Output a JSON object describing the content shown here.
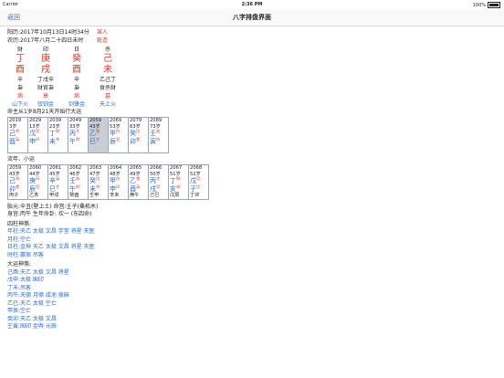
{
  "statusbar": {
    "carrier": "Carrier",
    "time": "2:36 PM",
    "battery": "100%"
  },
  "nav": {
    "back": "返回",
    "title": "八字排盘界面"
  },
  "info": {
    "solar": "阳历:2017年10月13日14时34分",
    "gender": "某人",
    "lunar": "农历:2017年八月二十四日未时",
    "zodiac": "乾造"
  },
  "pillars": [
    {
      "god": "财",
      "stem": "丁",
      "branch": "酉",
      "hidden": "辛",
      "hgods": "枭",
      "state": "病",
      "nayin": "山下火"
    },
    {
      "god": "印",
      "stem": "庚",
      "branch": "戌",
      "hidden": "丁戊辛",
      "hgods": "财官枭",
      "state": "衰",
      "nayin": "钗钏金"
    },
    {
      "god": "日",
      "stem": "癸",
      "branch": "酉",
      "hidden": "辛",
      "hgods": "枭",
      "state": "病",
      "nayin": "剑锋金"
    },
    {
      "god": "杀",
      "stem": "己",
      "branch": "未",
      "hidden": "乙己丁",
      "hgods": "食杀财",
      "state": "墓",
      "nayin": "天上火"
    }
  ],
  "dayun": {
    "title": "命主从1岁8月21天开始行大运",
    "items": [
      {
        "year": "2019",
        "age": "3岁",
        "stem": "己",
        "branch": "酉",
        "sg": "杀",
        "bg": "枭"
      },
      {
        "year": "2029",
        "age": "13岁",
        "stem": "戊",
        "branch": "申",
        "sg": "官",
        "bg": "印"
      },
      {
        "year": "2039",
        "age": "23岁",
        "stem": "丁",
        "branch": "未",
        "sg": "财",
        "bg": "杀"
      },
      {
        "year": "2049",
        "age": "33岁",
        "stem": "丙",
        "branch": "午",
        "sg": "才",
        "bg": "财"
      },
      {
        "year": "2059",
        "age": "43岁",
        "stem": "乙",
        "branch": "巳",
        "sg": "食",
        "bg": "才",
        "sel": true
      },
      {
        "year": "2069",
        "age": "53岁",
        "stem": "甲",
        "branch": "辰",
        "sg": "伤",
        "bg": "官"
      },
      {
        "year": "2079",
        "age": "63岁",
        "stem": "癸",
        "branch": "卯",
        "sg": "比",
        "bg": "食"
      },
      {
        "year": "2089",
        "age": "73岁",
        "stem": "壬",
        "branch": "寅",
        "sg": "劫",
        "bg": "伤"
      }
    ]
  },
  "liunian": {
    "title": "流年、小运",
    "items": [
      {
        "year": "2059",
        "age": "43岁",
        "stem": "己",
        "branch": "卯",
        "sg": "杀",
        "bg": "食",
        "xy": "丙子"
      },
      {
        "year": "2060",
        "age": "44岁",
        "stem": "庚",
        "branch": "辰",
        "sg": "印",
        "bg": "官",
        "xy": "乙亥"
      },
      {
        "year": "2061",
        "age": "45岁",
        "stem": "辛",
        "branch": "巳",
        "sg": "枭",
        "bg": "才",
        "xy": "甲戌"
      },
      {
        "year": "2062",
        "age": "46岁",
        "stem": "壬",
        "branch": "午",
        "sg": "劫",
        "bg": "财",
        "xy": "癸酉"
      },
      {
        "year": "2063",
        "age": "47岁",
        "stem": "癸",
        "branch": "未",
        "sg": "比",
        "bg": "杀",
        "xy": "壬申"
      },
      {
        "year": "2064",
        "age": "48岁",
        "stem": "甲",
        "branch": "申",
        "sg": "伤",
        "bg": "印",
        "xy": "辛未"
      },
      {
        "year": "2065",
        "age": "49岁",
        "stem": "乙",
        "branch": "酉",
        "sg": "食",
        "bg": "枭",
        "xy": "庚午"
      },
      {
        "year": "2066",
        "age": "50岁",
        "stem": "丙",
        "branch": "戌",
        "sg": "才",
        "bg": "官",
        "xy": "己巳"
      },
      {
        "year": "2067",
        "age": "51岁",
        "stem": "丁",
        "branch": "亥",
        "sg": "财",
        "bg": "劫",
        "xy": "戊辰"
      },
      {
        "year": "2068",
        "age": "52岁",
        "stem": "戊",
        "branch": "子",
        "sg": "官",
        "bg": "比",
        "xy": "丁卯"
      }
    ]
  },
  "extra": {
    "taiyuan": "胎元:辛丑(壁上土)  命宫:壬子(桑柘木)",
    "shengong": "身宫:丙午  生年命卦: 坎一 (东四命)"
  },
  "shensha": {
    "title": "四柱神煞:",
    "lines": [
      "年柱:天乙 太极 文昌 学堂 将星 天医",
      "月柱:空亡",
      "日柱:金神 天乙 太极 文昌 将星 天医",
      "时柱:寡宿 吊客"
    ]
  },
  "dayunshensha": {
    "title": "大运神煞:",
    "lines": [
      "己酉:天乙 太极 文昌 将星",
      "戊申:太极 国印",
      "丁未:吊客",
      "丙午:天德 月德 咸池 披麻",
      "乙巳:天乙 太极 空亡",
      "甲辰:空亡",
      "癸卯:天乙 太极 文昌",
      "壬寅:国印 金舆 元辰"
    ]
  },
  "colors": {
    "red": "#d93b2b",
    "blue": "#2b6cd4",
    "selected": "#c9cdd4"
  }
}
